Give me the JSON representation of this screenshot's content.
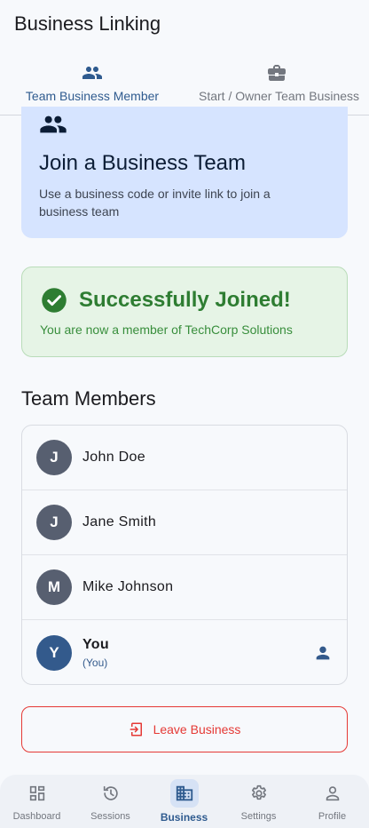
{
  "app": {
    "title": "Business Linking"
  },
  "tabs": [
    {
      "label": "Team Business Member",
      "icon": "group-icon",
      "active": true
    },
    {
      "label": "Start / Owner Team Business",
      "icon": "briefcase-icon",
      "active": false
    }
  ],
  "join_card": {
    "title": "Join a Business Team",
    "description": "Use a business code or invite link to join a business team",
    "icon": "group-icon"
  },
  "success": {
    "title": "Successfully Joined!",
    "message": "You are now a member of TechCorp Solutions",
    "icon": "check-circle-icon"
  },
  "members": {
    "heading": "Team Members",
    "items": [
      {
        "initial": "J",
        "name": "John Doe"
      },
      {
        "initial": "J",
        "name": "Jane Smith"
      },
      {
        "initial": "M",
        "name": "Mike Johnson"
      },
      {
        "initial": "Y",
        "name": "You",
        "subtitle": "(You)",
        "icon": "person-icon"
      }
    ]
  },
  "leave": {
    "label": "Leave Business",
    "icon": "exit-icon"
  },
  "nav": [
    {
      "label": "Dashboard",
      "icon": "dashboard-icon",
      "active": false
    },
    {
      "label": "Sessions",
      "icon": "history-icon",
      "active": false
    },
    {
      "label": "Business",
      "icon": "building-icon",
      "active": true
    },
    {
      "label": "Settings",
      "icon": "gear-icon",
      "active": false
    },
    {
      "label": "Profile",
      "icon": "person-icon",
      "active": false
    }
  ],
  "colors": {
    "primary": "#2f5b8f",
    "join_bg": "#d6e4ff",
    "success_bg": "#e6f4e6",
    "success_text": "#2e7d32",
    "danger": "#e53935",
    "avatar": "#575f70",
    "avatar_you": "#335a8c"
  }
}
